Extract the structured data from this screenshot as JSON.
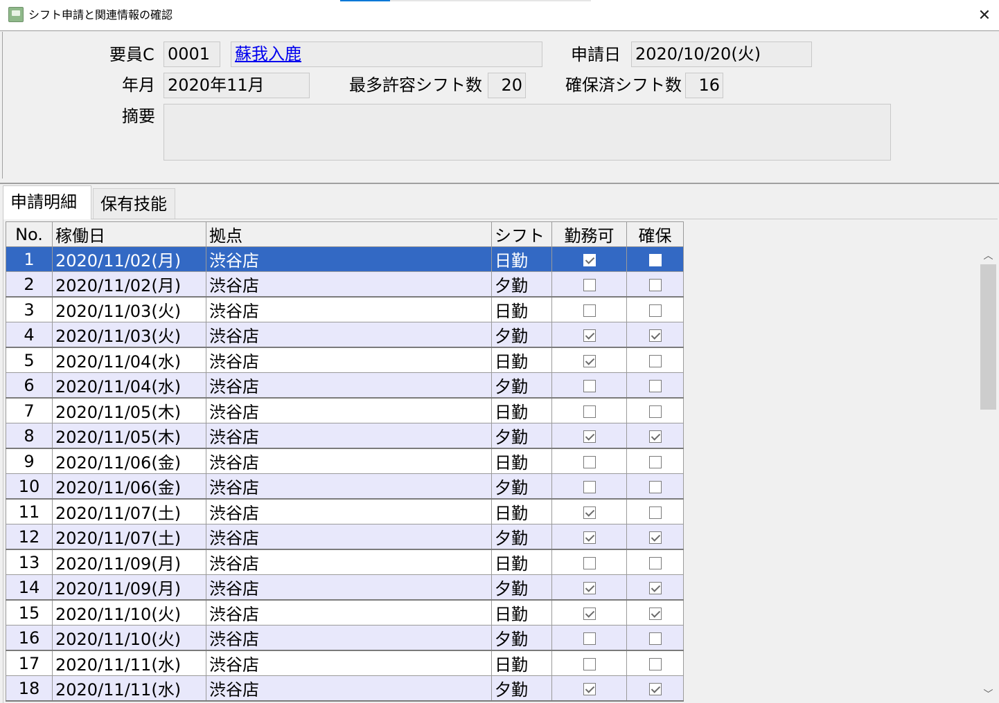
{
  "window": {
    "title": "シフト申請と関連情報の確認",
    "close_glyph": "✕"
  },
  "form": {
    "staff_code_label": "要員C",
    "staff_code": "0001",
    "staff_name": "蘇我入鹿",
    "apply_date_label": "申請日",
    "apply_date": "2020/10/20(火)",
    "year_month_label": "年月",
    "year_month": "2020年11月",
    "max_shifts_label": "最多許容シフト数",
    "max_shifts": "20",
    "secured_shifts_label": "確保済シフト数",
    "secured_shifts": "16",
    "summary_label": "摘要",
    "summary": ""
  },
  "tabs": [
    {
      "label": "申請明細",
      "active": true
    },
    {
      "label": "保有技能",
      "active": false
    }
  ],
  "grid": {
    "columns": [
      "No.",
      "稼働日",
      "拠点",
      "シフト",
      "勤務可",
      "確保"
    ],
    "selected_row": 0,
    "rows": [
      {
        "no": "1",
        "date": "2020/11/02(月)",
        "site": "渋谷店",
        "shift": "日勤",
        "available": true,
        "secured": false
      },
      {
        "no": "2",
        "date": "2020/11/02(月)",
        "site": "渋谷店",
        "shift": "夕勤",
        "available": false,
        "secured": false
      },
      {
        "no": "3",
        "date": "2020/11/03(火)",
        "site": "渋谷店",
        "shift": "日勤",
        "available": false,
        "secured": false
      },
      {
        "no": "4",
        "date": "2020/11/03(火)",
        "site": "渋谷店",
        "shift": "夕勤",
        "available": true,
        "secured": true
      },
      {
        "no": "5",
        "date": "2020/11/04(水)",
        "site": "渋谷店",
        "shift": "日勤",
        "available": true,
        "secured": false
      },
      {
        "no": "6",
        "date": "2020/11/04(水)",
        "site": "渋谷店",
        "shift": "夕勤",
        "available": false,
        "secured": false
      },
      {
        "no": "7",
        "date": "2020/11/05(木)",
        "site": "渋谷店",
        "shift": "日勤",
        "available": false,
        "secured": false
      },
      {
        "no": "8",
        "date": "2020/11/05(木)",
        "site": "渋谷店",
        "shift": "夕勤",
        "available": true,
        "secured": true
      },
      {
        "no": "9",
        "date": "2020/11/06(金)",
        "site": "渋谷店",
        "shift": "日勤",
        "available": false,
        "secured": false
      },
      {
        "no": "10",
        "date": "2020/11/06(金)",
        "site": "渋谷店",
        "shift": "夕勤",
        "available": false,
        "secured": false
      },
      {
        "no": "11",
        "date": "2020/11/07(土)",
        "site": "渋谷店",
        "shift": "日勤",
        "available": true,
        "secured": false
      },
      {
        "no": "12",
        "date": "2020/11/07(土)",
        "site": "渋谷店",
        "shift": "夕勤",
        "available": true,
        "secured": true
      },
      {
        "no": "13",
        "date": "2020/11/09(月)",
        "site": "渋谷店",
        "shift": "日勤",
        "available": false,
        "secured": false
      },
      {
        "no": "14",
        "date": "2020/11/09(月)",
        "site": "渋谷店",
        "shift": "夕勤",
        "available": true,
        "secured": true
      },
      {
        "no": "15",
        "date": "2020/11/10(火)",
        "site": "渋谷店",
        "shift": "日勤",
        "available": true,
        "secured": true
      },
      {
        "no": "16",
        "date": "2020/11/10(火)",
        "site": "渋谷店",
        "shift": "夕勤",
        "available": false,
        "secured": false
      },
      {
        "no": "17",
        "date": "2020/11/11(水)",
        "site": "渋谷店",
        "shift": "日勤",
        "available": false,
        "secured": false
      },
      {
        "no": "18",
        "date": "2020/11/11(水)",
        "site": "渋谷店",
        "shift": "夕勤",
        "available": true,
        "secured": true
      }
    ]
  },
  "scrollbar": {
    "up_glyph": "︿",
    "down_glyph": "﹀"
  }
}
